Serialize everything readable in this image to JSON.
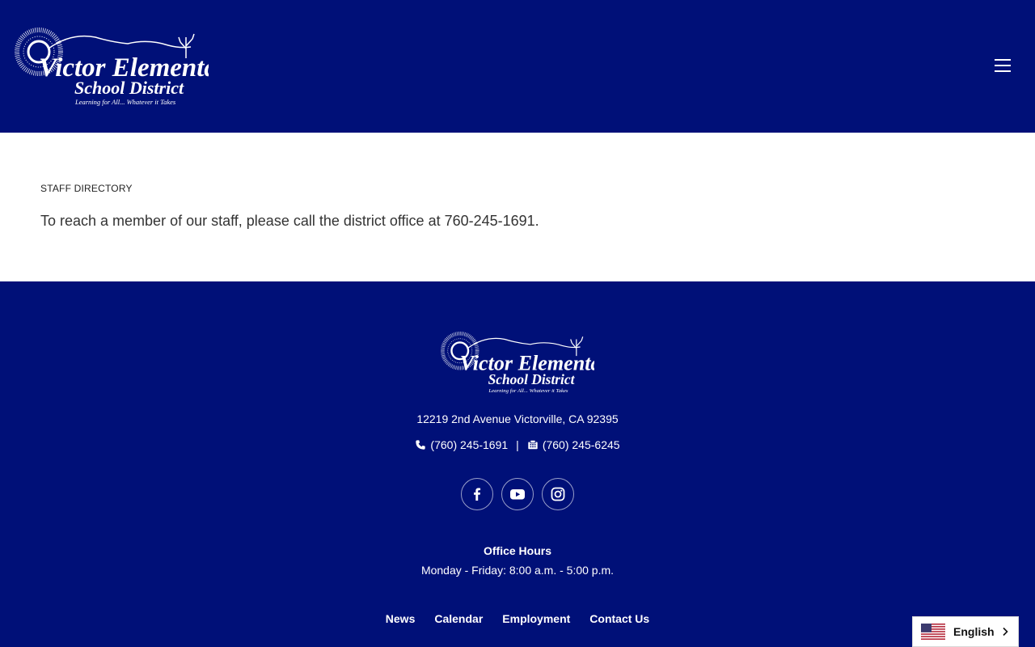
{
  "brand": {
    "name_line1": "Victor Elementary",
    "name_line2": "School District",
    "tagline": "Learning for All... Whatever it Takes"
  },
  "header": {
    "menu_icon": "hamburger-menu-icon"
  },
  "main": {
    "eyebrow": "STAFF DIRECTORY",
    "body": "To reach a member of our staff, please call the district office at 760-245-1691."
  },
  "footer": {
    "address": "12219 2nd Avenue Victorville, CA  92395",
    "phone": "(760) 245-1691",
    "fax": "(760) 245-6245",
    "separator": "|",
    "social": [
      {
        "name": "facebook",
        "icon": "facebook-icon"
      },
      {
        "name": "youtube",
        "icon": "youtube-icon"
      },
      {
        "name": "instagram",
        "icon": "instagram-icon"
      }
    ],
    "hours_title": "Office Hours",
    "hours": "Monday - Friday: 8:00 a.m. - 5:00 p.m.",
    "links": [
      "News",
      "Calendar",
      "Employment",
      "Contact Us"
    ]
  },
  "language": {
    "label": "English",
    "flag_icon": "us-flag-icon"
  },
  "colors": {
    "brand_navy": "#001078",
    "white": "#ffffff"
  }
}
